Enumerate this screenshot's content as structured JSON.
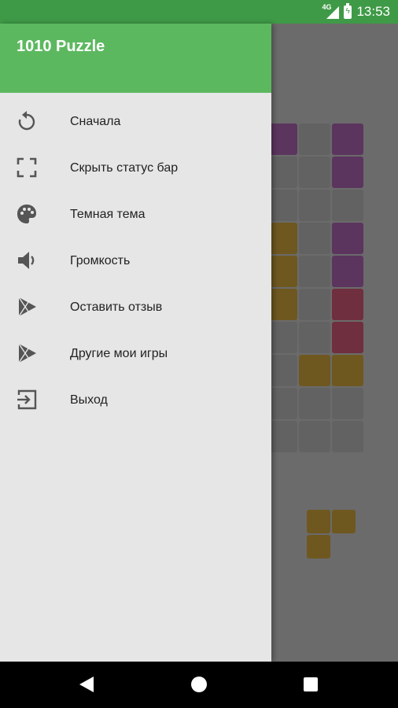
{
  "status_bar": {
    "network": "4G",
    "time": "13:53",
    "icons": [
      "signal-icon",
      "battery-charging-icon"
    ]
  },
  "drawer": {
    "title": "1010 Puzzle",
    "items": [
      {
        "label": "Сначала",
        "icon": "restart-icon"
      },
      {
        "label": "Скрыть статус бар",
        "icon": "fullscreen-icon"
      },
      {
        "label": "Темная тема",
        "icon": "palette-icon"
      },
      {
        "label": "Громкость",
        "icon": "volume-icon"
      },
      {
        "label": "Оставить отзыв",
        "icon": "play-store-icon"
      },
      {
        "label": "Другие мои игры",
        "icon": "play-store-icon"
      },
      {
        "label": "Выход",
        "icon": "exit-icon"
      }
    ]
  },
  "colors": {
    "header": "#5cb85f",
    "status_bar": "#3f9a47",
    "drawer_bg": "#e6e6e6",
    "purple_block": "#5c355f",
    "gold_block": "#6f5820",
    "red_block": "#6f2f3e",
    "empty_cell": "#626262"
  }
}
